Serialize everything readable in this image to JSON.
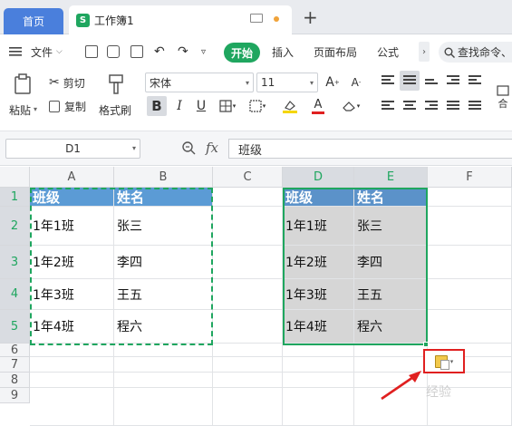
{
  "tabs": {
    "home": "首页",
    "doc_icon": "S",
    "doc_name": "工作簿1",
    "add": "+"
  },
  "menu": {
    "file": "文件",
    "start": "开始",
    "insert": "插入",
    "layout": "页面布局",
    "formula": "公式",
    "search": "查找命令、"
  },
  "ribbon": {
    "paste": "粘贴",
    "cut": "剪切",
    "copy": "复制",
    "format_painter": "格式刷",
    "font_name": "宋体",
    "font_size": "11",
    "bold": "B",
    "italic": "I",
    "underline": "U",
    "merge": "合"
  },
  "formula_bar": {
    "name_box": "D1",
    "fx": "fx",
    "value": "班级"
  },
  "columns": [
    "A",
    "B",
    "C",
    "D",
    "E",
    "F"
  ],
  "rows": [
    "1",
    "2",
    "3",
    "4",
    "5",
    "6",
    "7",
    "8",
    "9"
  ],
  "cells": {
    "A1": "班级",
    "B1": "姓名",
    "A2": "1年1班",
    "B2": "张三",
    "A3": "1年2班",
    "B3": "李四",
    "A4": "1年3班",
    "B4": "王五",
    "A5": "1年4班",
    "B5": "程六",
    "D1": "班级",
    "E1": "姓名",
    "D2": "1年1班",
    "E2": "张三",
    "D3": "1年2班",
    "E3": "李四",
    "D4": "1年3班",
    "E4": "王五",
    "D5": "1年4班",
    "E5": "程六"
  },
  "watermark": "经验",
  "colors": {
    "accent": "#1fa65f",
    "header_fill": "#5b9bd5",
    "highlight": "#e02020"
  }
}
